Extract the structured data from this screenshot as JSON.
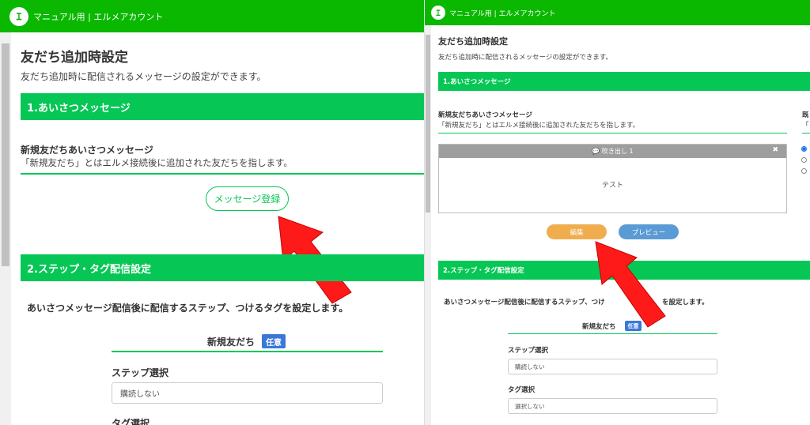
{
  "app": {
    "title": "マニュアル用 | エルメアカウント",
    "logo_glyph": "ｴ"
  },
  "page": {
    "title": "友だち追加時設定",
    "description": "友だち追加時に配信されるメッセージの設定ができます。"
  },
  "section1": {
    "header": "1.あいさつメッセージ",
    "new_friend_title": "新規友だちあいさつメッセージ",
    "new_friend_desc": "「新規友だち」とはエルメ接続後に追加された友だちを指します。",
    "register_button": "メッセージ登録",
    "existing_title_partial": "既",
    "existing_desc_partial": "「",
    "bubble": {
      "header": "💬 吹き出し 1",
      "close": "✖",
      "body": "テスト"
    },
    "edit_button": "編集",
    "preview_button": "プレビュー"
  },
  "section2": {
    "header": "2.ステップ・タグ配信設定",
    "desc": "あいさつメッセージ配信後に配信するステップ、つけるタグを設定します。",
    "desc_partial": "あいさつメッセージ配信後に配信するステップ、つけ",
    "desc_partial_tail": "を設定します。",
    "subheading": "新規友だち",
    "optional_badge": "任意",
    "step_label": "ステップ選択",
    "step_value": "購読しない",
    "tag_label": "タグ選択",
    "tag_value": "選択しない"
  },
  "colors": {
    "topbar": "#0ab800",
    "section_header": "#06c755",
    "edit_button": "#f0ad4e",
    "preview_button": "#5b9bd5",
    "badge": "#3a78d8",
    "arrow": "#ff1a1a"
  }
}
